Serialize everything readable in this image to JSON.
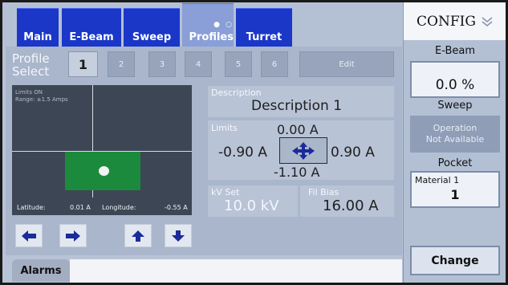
{
  "tabs": [
    {
      "label": "Main"
    },
    {
      "label": "E-Beam"
    },
    {
      "label": "Sweep"
    },
    {
      "label": "Profiles",
      "indicator": "● ○"
    },
    {
      "label": "Turret"
    }
  ],
  "profile": {
    "label_line1": "Profile",
    "label_line2": "Select",
    "buttons": [
      "1",
      "2",
      "3",
      "4",
      "5",
      "6"
    ],
    "selected": "1",
    "edit_label": "Edit"
  },
  "graph": {
    "status": "Limits ON",
    "range": "Range: ±1.5 Amps",
    "latitude_label": "Latitude:",
    "latitude_value": "0.01 A",
    "longitude_label": "Longitude:",
    "longitude_value": "-0.55 A"
  },
  "description": {
    "label": "Description",
    "value": "Description 1"
  },
  "limits": {
    "label": "Limits",
    "top": "0.00 A",
    "left": "-0.90 A",
    "right": "0.90 A",
    "bottom": "-1.10 A"
  },
  "kv": {
    "label": "kV Set",
    "value": "10.0 kV"
  },
  "fil": {
    "label": "Fil Bias",
    "value": "16.00 A"
  },
  "alarms_label": "Alarms",
  "config": {
    "title": "CONFIG",
    "ebeam_title": "E-Beam",
    "ebeam_value": "0.0 %",
    "sweep_title": "Sweep",
    "sweep_line1": "Operation",
    "sweep_line2": "Not Available",
    "pocket_title": "Pocket",
    "pocket_material": "Material 1",
    "pocket_number": "1",
    "change_label": "Change"
  },
  "colors": {
    "tab_blue": "#1a37c8",
    "zone_green": "#1c8a3c",
    "panel": "#a9b6cb"
  }
}
